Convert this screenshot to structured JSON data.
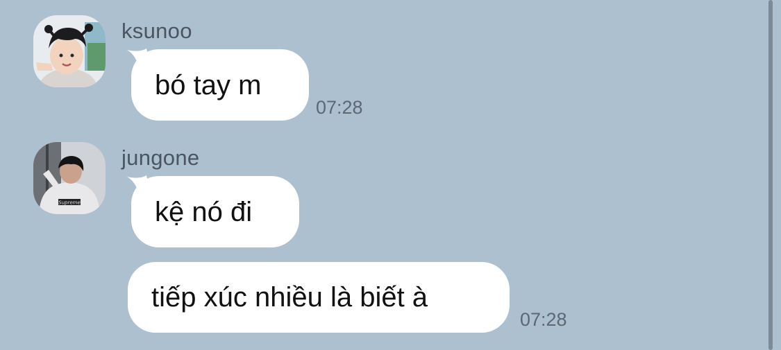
{
  "messages": [
    {
      "sender": "ksunoo",
      "avatar": "child-photo-avatar",
      "bubbles": [
        {
          "text": "bó tay m",
          "time": "07:28"
        }
      ]
    },
    {
      "sender": "jungone",
      "avatar": "hoodie-photo-avatar",
      "bubbles": [
        {
          "text": "kệ nó đi",
          "time": ""
        },
        {
          "text": "tiếp xúc nhiều là biết à",
          "time": "07:28"
        }
      ]
    }
  ],
  "colors": {
    "background": "#adc0cf",
    "bubble": "#ffffff",
    "timestamp": "#5c6873",
    "sender": "#4a5560"
  }
}
